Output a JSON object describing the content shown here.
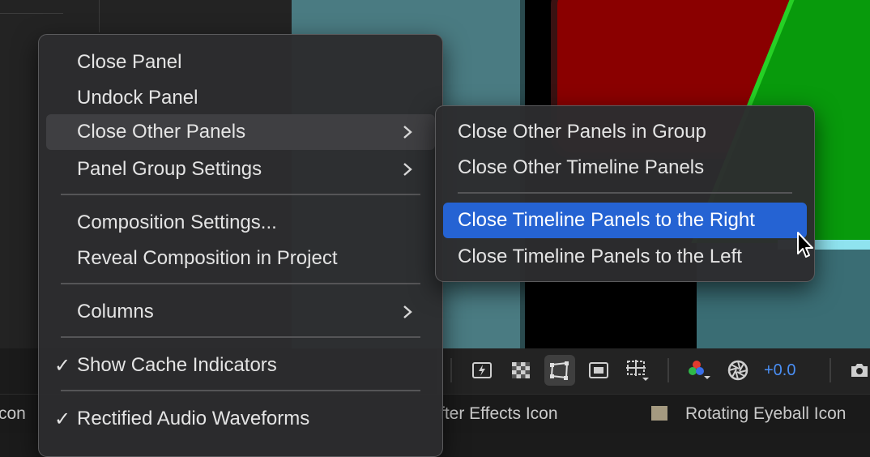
{
  "main_menu": {
    "items": [
      {
        "label": "Close Panel"
      },
      {
        "label": "Undock Panel"
      },
      {
        "label": "Close Other Panels"
      },
      {
        "label": "Panel Group Settings"
      },
      {
        "label": "Composition Settings..."
      },
      {
        "label": "Reveal Composition in Project"
      },
      {
        "label": "Columns"
      },
      {
        "label": "Show Cache Indicators",
        "check": "✓"
      },
      {
        "label": "Rectified Audio Waveforms",
        "check": "✓"
      }
    ]
  },
  "sub_menu": {
    "items": [
      {
        "label": "Close Other Panels in Group"
      },
      {
        "label": "Close Other Timeline Panels"
      },
      {
        "label": "Close Timeline Panels to the Right"
      },
      {
        "label": "Close Timeline Panels to the Left"
      }
    ]
  },
  "toolbar": {
    "exposure_value": "+0.0",
    "icons": [
      "fast-previews-icon",
      "transparency-grid-icon",
      "mask-path-icon",
      "safe-zones-icon",
      "grid-guides-icon",
      "rgb-channels-icon",
      "reset-exposure-icon",
      "snapshot-icon"
    ]
  },
  "tabs": {
    "left": "con",
    "middle": "fter Effects Icon",
    "right": "Rotating Eyeball Icon"
  },
  "colors": {
    "selection": "#2563d3",
    "exposure": "#4a8ff5",
    "label_swatch": "#a59a80"
  }
}
